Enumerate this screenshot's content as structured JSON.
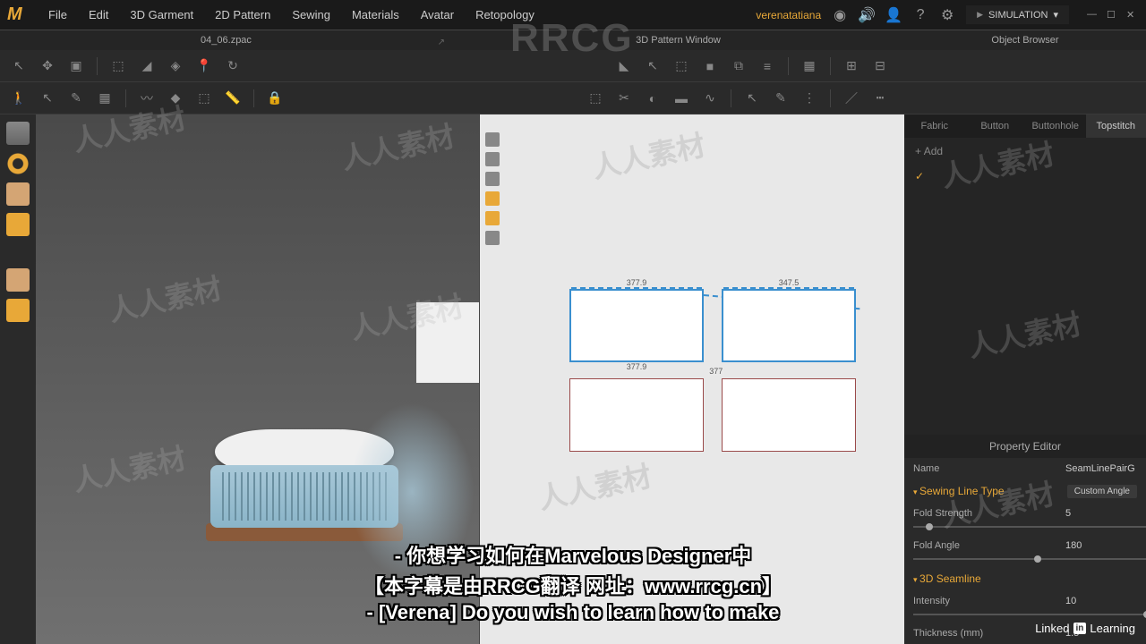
{
  "app": {
    "logo": "M"
  },
  "menu": [
    "File",
    "Edit",
    "3D Garment",
    "2D Pattern",
    "Sewing",
    "Materials",
    "Avatar",
    "Retopology"
  ],
  "user": "verenatatiana",
  "simulation_btn": "SIMULATION",
  "subheader": {
    "left": "04_06.zpac",
    "center": "3D Pattern Window",
    "right": "Object Browser"
  },
  "tabs": [
    "Fabric",
    "Button",
    "Buttonhole",
    "Topstitch"
  ],
  "add_label": "Add",
  "check_label": "✓",
  "pattern_dims": {
    "top": "377.9",
    "bottom": "377.9",
    "right_top": "347.5",
    "mid": "377"
  },
  "property_editor": {
    "title": "Property Editor",
    "name_label": "Name",
    "name_value": "SeamLinePairG",
    "section1": "Sewing Line Type",
    "section1_value": "Custom Angle",
    "fold_strength_label": "Fold Strength",
    "fold_strength_value": "5",
    "fold_angle_label": "Fold Angle",
    "fold_angle_value": "180",
    "section2": "3D Seamline",
    "intensity_label": "Intensity",
    "intensity_value": "10",
    "thickness_label": "Thickness (mm)",
    "thickness_value": "1.5"
  },
  "subtitles": {
    "line1": "- 你想学习如何在Marvelous Designer中",
    "line2": "【本字幕是由RRCG翻译 网址：www.rrcg.cn】",
    "line3": "- [Verena] Do you wish to learn how to make"
  },
  "watermark_text": "人人素材",
  "big_watermark": "RRCG",
  "linkedin": {
    "prefix": "Linked",
    "box": "in",
    "suffix": "Learning"
  }
}
